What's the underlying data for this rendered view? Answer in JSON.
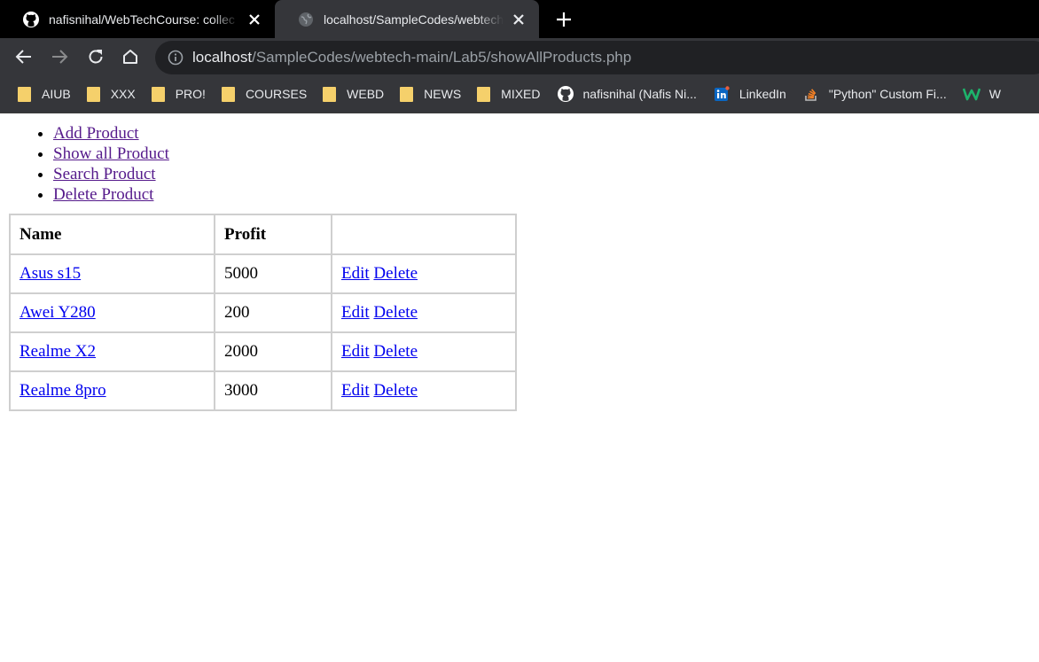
{
  "browser": {
    "tabs": [
      {
        "title": "nafisnihal/WebTechCourse: collec",
        "favicon": "github-icon",
        "active": false
      },
      {
        "title": "localhost/SampleCodes/webtech",
        "favicon": "globe-icon",
        "active": true
      }
    ],
    "address": {
      "host": "localhost",
      "path": "/SampleCodes/webtech-main/Lab5/showAllProducts.php"
    },
    "bookmarks": [
      {
        "label": "AIUB",
        "icon": "folder-icon"
      },
      {
        "label": "XXX",
        "icon": "folder-icon"
      },
      {
        "label": "PRO!",
        "icon": "folder-icon"
      },
      {
        "label": "COURSES",
        "icon": "folder-icon"
      },
      {
        "label": "WEBD",
        "icon": "folder-icon"
      },
      {
        "label": "NEWS",
        "icon": "folder-icon"
      },
      {
        "label": "MIXED",
        "icon": "folder-icon"
      },
      {
        "label": "nafisnihal (Nafis Ni...",
        "icon": "github-icon"
      },
      {
        "label": "LinkedIn",
        "icon": "linkedin-icon"
      },
      {
        "label": "\"Python\" Custom Fi...",
        "icon": "stackoverflow-icon"
      },
      {
        "label": "W",
        "icon": "w-icon"
      }
    ]
  },
  "menu": {
    "items": [
      "Add Product",
      "Show all Product",
      "Search Product",
      "Delete Product"
    ]
  },
  "table": {
    "headers": [
      "Name",
      "Profit",
      ""
    ],
    "rows": [
      {
        "name": "Asus s15",
        "profit": "5000",
        "edit": "Edit",
        "delete": "Delete"
      },
      {
        "name": "Awei Y280",
        "profit": "200",
        "edit": "Edit",
        "delete": "Delete"
      },
      {
        "name": "Realme X2",
        "profit": "2000",
        "edit": "Edit",
        "delete": "Delete"
      },
      {
        "name": "Realme 8pro",
        "profit": "3000",
        "edit": "Edit",
        "delete": "Delete"
      }
    ]
  },
  "colors": {
    "tabstrip": "#000000",
    "toolbar": "#35363a",
    "omnibox": "#202124",
    "link": "#0000ee",
    "visited_link": "#551a8b",
    "folder": "#f5d06b"
  }
}
